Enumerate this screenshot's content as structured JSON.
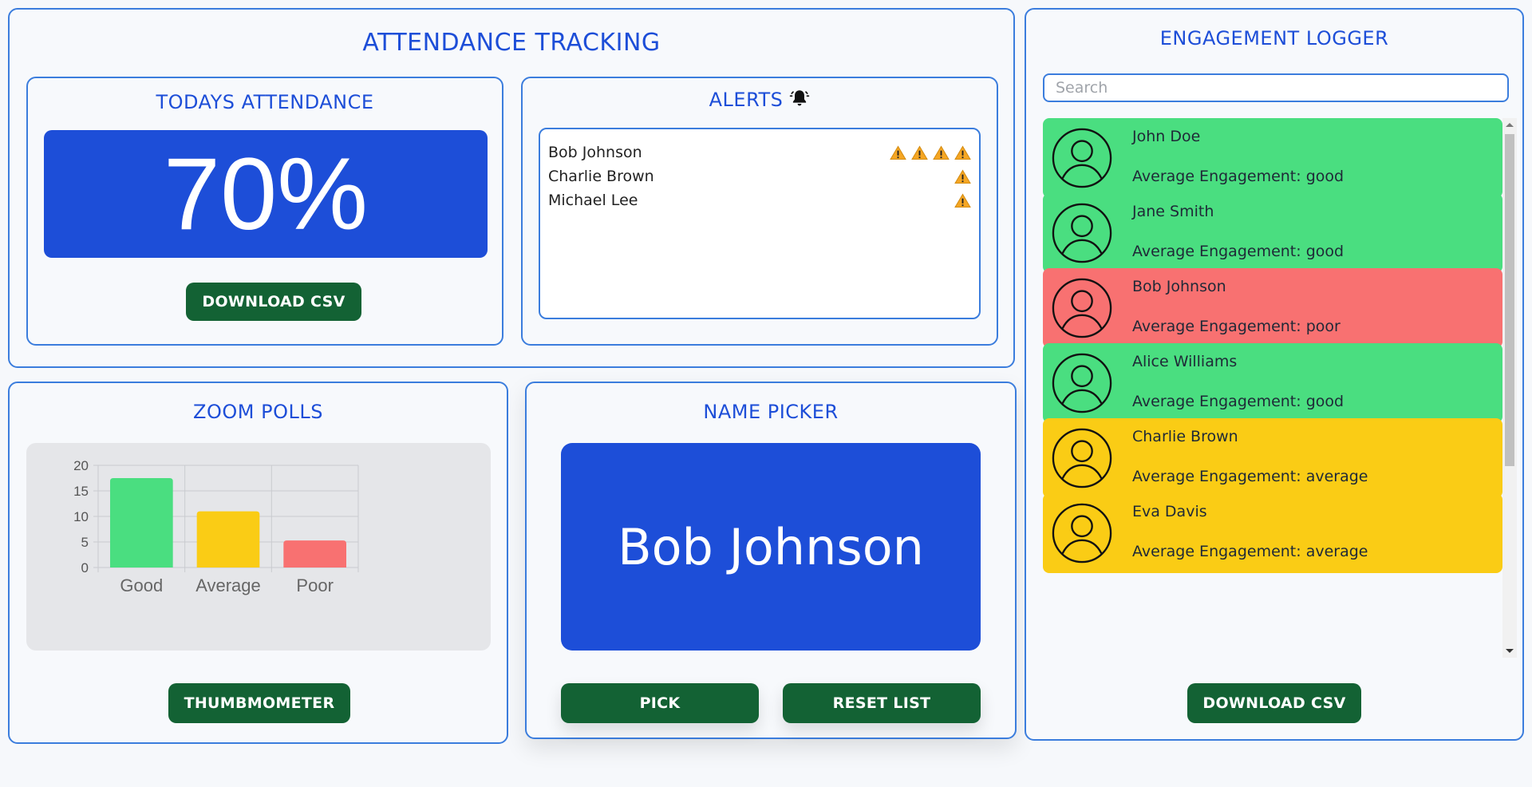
{
  "attendance": {
    "title": "ATTENDANCE TRACKING",
    "today_title": "TODAYS ATTENDANCE",
    "percentage": "70%",
    "download_label": "DOWNLOAD CSV",
    "alerts_title": "ALERTS",
    "alerts": [
      {
        "name": "Bob Johnson",
        "warnings": 4
      },
      {
        "name": "Charlie Brown",
        "warnings": 1
      },
      {
        "name": "Michael Lee",
        "warnings": 1
      }
    ]
  },
  "polls": {
    "title": "ZOOM POLLS",
    "button_label": "THUMBMOMETER"
  },
  "chart_data": {
    "type": "bar",
    "categories": [
      "Good",
      "Average",
      "Poor"
    ],
    "values": [
      17.5,
      11,
      5.3
    ],
    "colors": [
      "#4ade80",
      "#facc15",
      "#f87171"
    ],
    "ylim": [
      0,
      20
    ],
    "yticks": [
      0,
      5,
      10,
      15,
      20
    ],
    "grid": true
  },
  "picker": {
    "title": "NAME PICKER",
    "picked_name": "Bob Johnson",
    "pick_label": "PICK",
    "reset_label": "RESET LIST"
  },
  "engagement": {
    "title": "ENGAGEMENT LOGGER",
    "search_placeholder": "Search",
    "download_label": "DOWNLOAD CSV",
    "students": [
      {
        "name": "John Doe",
        "engagement": "Average Engagement: good",
        "color": "#4ade80"
      },
      {
        "name": "Jane Smith",
        "engagement": "Average Engagement: good",
        "color": "#4ade80"
      },
      {
        "name": "Bob Johnson",
        "engagement": "Average Engagement: poor",
        "color": "#f87171"
      },
      {
        "name": "Alice Williams",
        "engagement": "Average Engagement: good",
        "color": "#4ade80"
      },
      {
        "name": "Charlie Brown",
        "engagement": "Average Engagement: average",
        "color": "#facc15"
      },
      {
        "name": "Eva Davis",
        "engagement": "Average Engagement: average",
        "color": "#facc15"
      }
    ]
  }
}
